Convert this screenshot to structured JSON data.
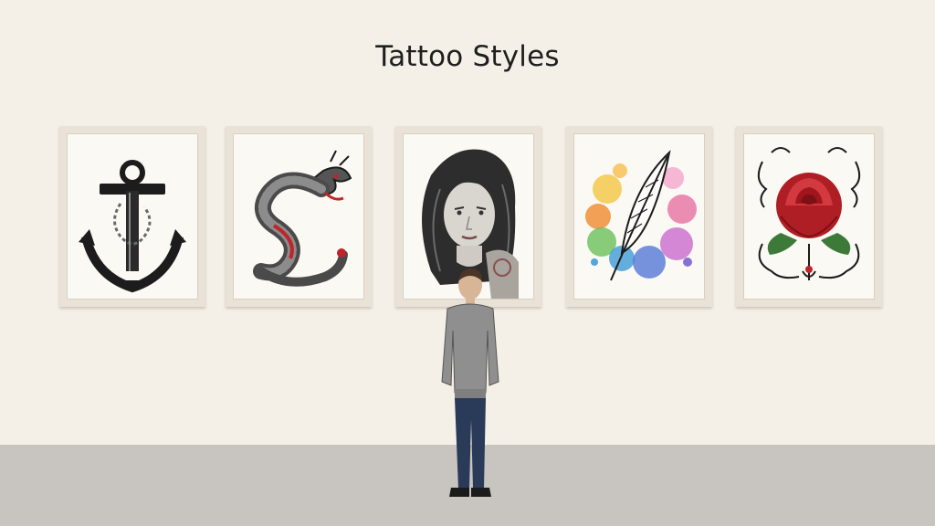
{
  "title": "Tattoo Styles",
  "artworks": [
    {
      "icon": "anchor-icon",
      "subject": "anchor"
    },
    {
      "icon": "dragon-icon",
      "subject": "dragon"
    },
    {
      "icon": "portrait-icon",
      "subject": "portrait"
    },
    {
      "icon": "feather-icon",
      "subject": "feather"
    },
    {
      "icon": "rose-icon",
      "subject": "rose"
    }
  ],
  "colors": {
    "wall": "#f5f0e7",
    "floor": "#c8c5c0",
    "frame": "#e9e2d7",
    "rose": "#c0242a",
    "ink": "#1c1c1c"
  }
}
